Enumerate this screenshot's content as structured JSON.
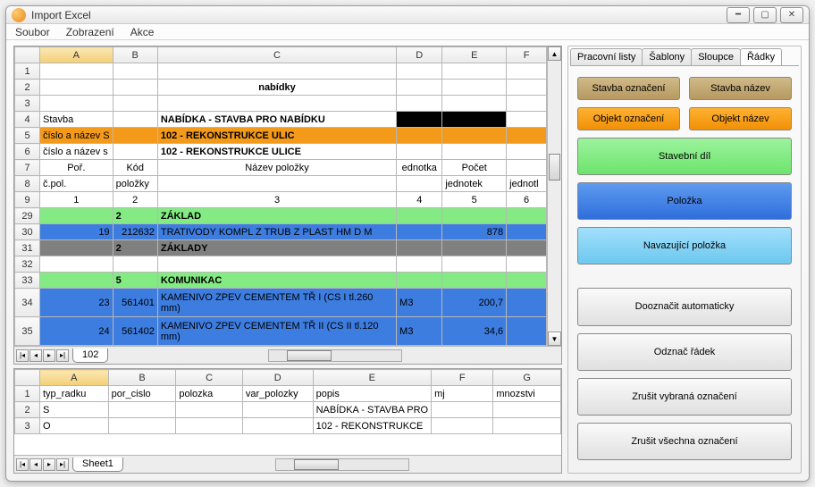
{
  "window": {
    "title": "Import Excel"
  },
  "menu": {
    "soubor": "Soubor",
    "zobrazeni": "Zobrazení",
    "akce": "Akce"
  },
  "topgrid": {
    "cols": [
      "A",
      "B",
      "C",
      "D",
      "E",
      "F"
    ],
    "rows": [
      {
        "n": "1",
        "cells": [
          "",
          "",
          "",
          "",
          "",
          ""
        ]
      },
      {
        "n": "2",
        "cells": [
          "",
          "",
          "nabídky",
          "",
          "",
          ""
        ],
        "cls": "",
        "bold": true,
        "center_c": true
      },
      {
        "n": "3",
        "cells": [
          "",
          "",
          "",
          "",
          "",
          ""
        ]
      },
      {
        "n": "4",
        "cells": [
          "Stavba",
          "",
          "NABÍDKA - STAVBA PRO NABÍDKU",
          "",
          "",
          ""
        ],
        "cls": "",
        "bold_c": true,
        "black_de": true
      },
      {
        "n": "5",
        "cells": [
          "číslo a název S",
          "",
          "102 - REKONSTRUKCE ULIC",
          "",
          "",
          ""
        ],
        "cls": "orange",
        "bold_c": true
      },
      {
        "n": "6",
        "cells": [
          "číslo a název s",
          "",
          "102 - REKONSTRUKCE ULICE",
          "",
          "",
          ""
        ],
        "bold_c": true
      },
      {
        "n": "7",
        "cells": [
          "Poř.",
          "Kód",
          "Název položky",
          "ednotka",
          "Počet",
          ""
        ],
        "center": true
      },
      {
        "n": "8",
        "cells": [
          "č.pol.",
          "položky",
          "",
          "",
          "jednotek",
          "jednotl"
        ]
      },
      {
        "n": "9",
        "cells": [
          "1",
          "2",
          "3",
          "4",
          "5",
          "6"
        ],
        "center": true
      },
      {
        "n": "29",
        "cells": [
          "",
          "2",
          "ZÁKLAD",
          "",
          "",
          ""
        ],
        "cls": "greenrow",
        "bold": true
      },
      {
        "n": "30",
        "cells": [
          "19",
          "212632",
          "TRATIVODY KOMPL Z TRUB Z PLAST HM D M",
          "",
          "878",
          ""
        ],
        "cls": "bluerow",
        "right_a": true
      },
      {
        "n": "31",
        "cells": [
          "",
          "2",
          "ZÁKLADY",
          "",
          "",
          ""
        ],
        "cls": "grayrow",
        "bold": true
      },
      {
        "n": "32",
        "cells": [
          "",
          "",
          "",
          "",
          "",
          ""
        ]
      },
      {
        "n": "33",
        "cells": [
          "",
          "5",
          "KOMUNIKAC",
          "",
          "",
          ""
        ],
        "cls": "greenrow",
        "bold": true
      },
      {
        "n": "34",
        "cells": [
          "23",
          "561401",
          "KAMENIVO ZPEV CEMENTEM TŘ I (CS I tl.260 mm)",
          "M3",
          "200,7",
          ""
        ],
        "cls": "bluerow",
        "right_a": true,
        "tall": true
      },
      {
        "n": "35",
        "cells": [
          "24",
          "561402",
          "KAMENIVO ZPEV CEMENTEM TŘ II (CS II tl.120 mm)",
          "M3",
          "34,6",
          ""
        ],
        "cls": "bluerow",
        "right_a": true,
        "tall": true
      }
    ],
    "sheet": "102"
  },
  "bottomgrid": {
    "cols": [
      "A",
      "B",
      "C",
      "D",
      "E",
      "F",
      "G"
    ],
    "rows": [
      {
        "n": "1",
        "cells": [
          "typ_radku",
          "por_cislo",
          "polozka",
          "var_polozky",
          "popis",
          "mj",
          "mnozstvi"
        ]
      },
      {
        "n": "2",
        "cells": [
          "S",
          "",
          "",
          "",
          "NABÍDKA - STAVBA PRO",
          "",
          ""
        ]
      },
      {
        "n": "3",
        "cells": [
          "O",
          "",
          "",
          "",
          "102 - REKONSTRUKCE",
          "",
          ""
        ]
      }
    ],
    "sheet": "Sheet1"
  },
  "tabs": {
    "t1": "Pracovní listy",
    "t2": "Šablony",
    "t3": "Sloupce",
    "t4": "Řádky"
  },
  "buttons": {
    "stavba_ozn": "Stavba označení",
    "stavba_naz": "Stavba název",
    "objekt_ozn": "Objekt označení",
    "objekt_naz": "Objekt název",
    "stav_dil": "Stavební díl",
    "polozka": "Položka",
    "navaz": "Navazující položka",
    "auto": "Dooznačit automaticky",
    "odznac": "Odznač řádek",
    "zrus_vyb": "Zrušit vybraná označení",
    "zrus_vse": "Zrušit všechna označení"
  }
}
